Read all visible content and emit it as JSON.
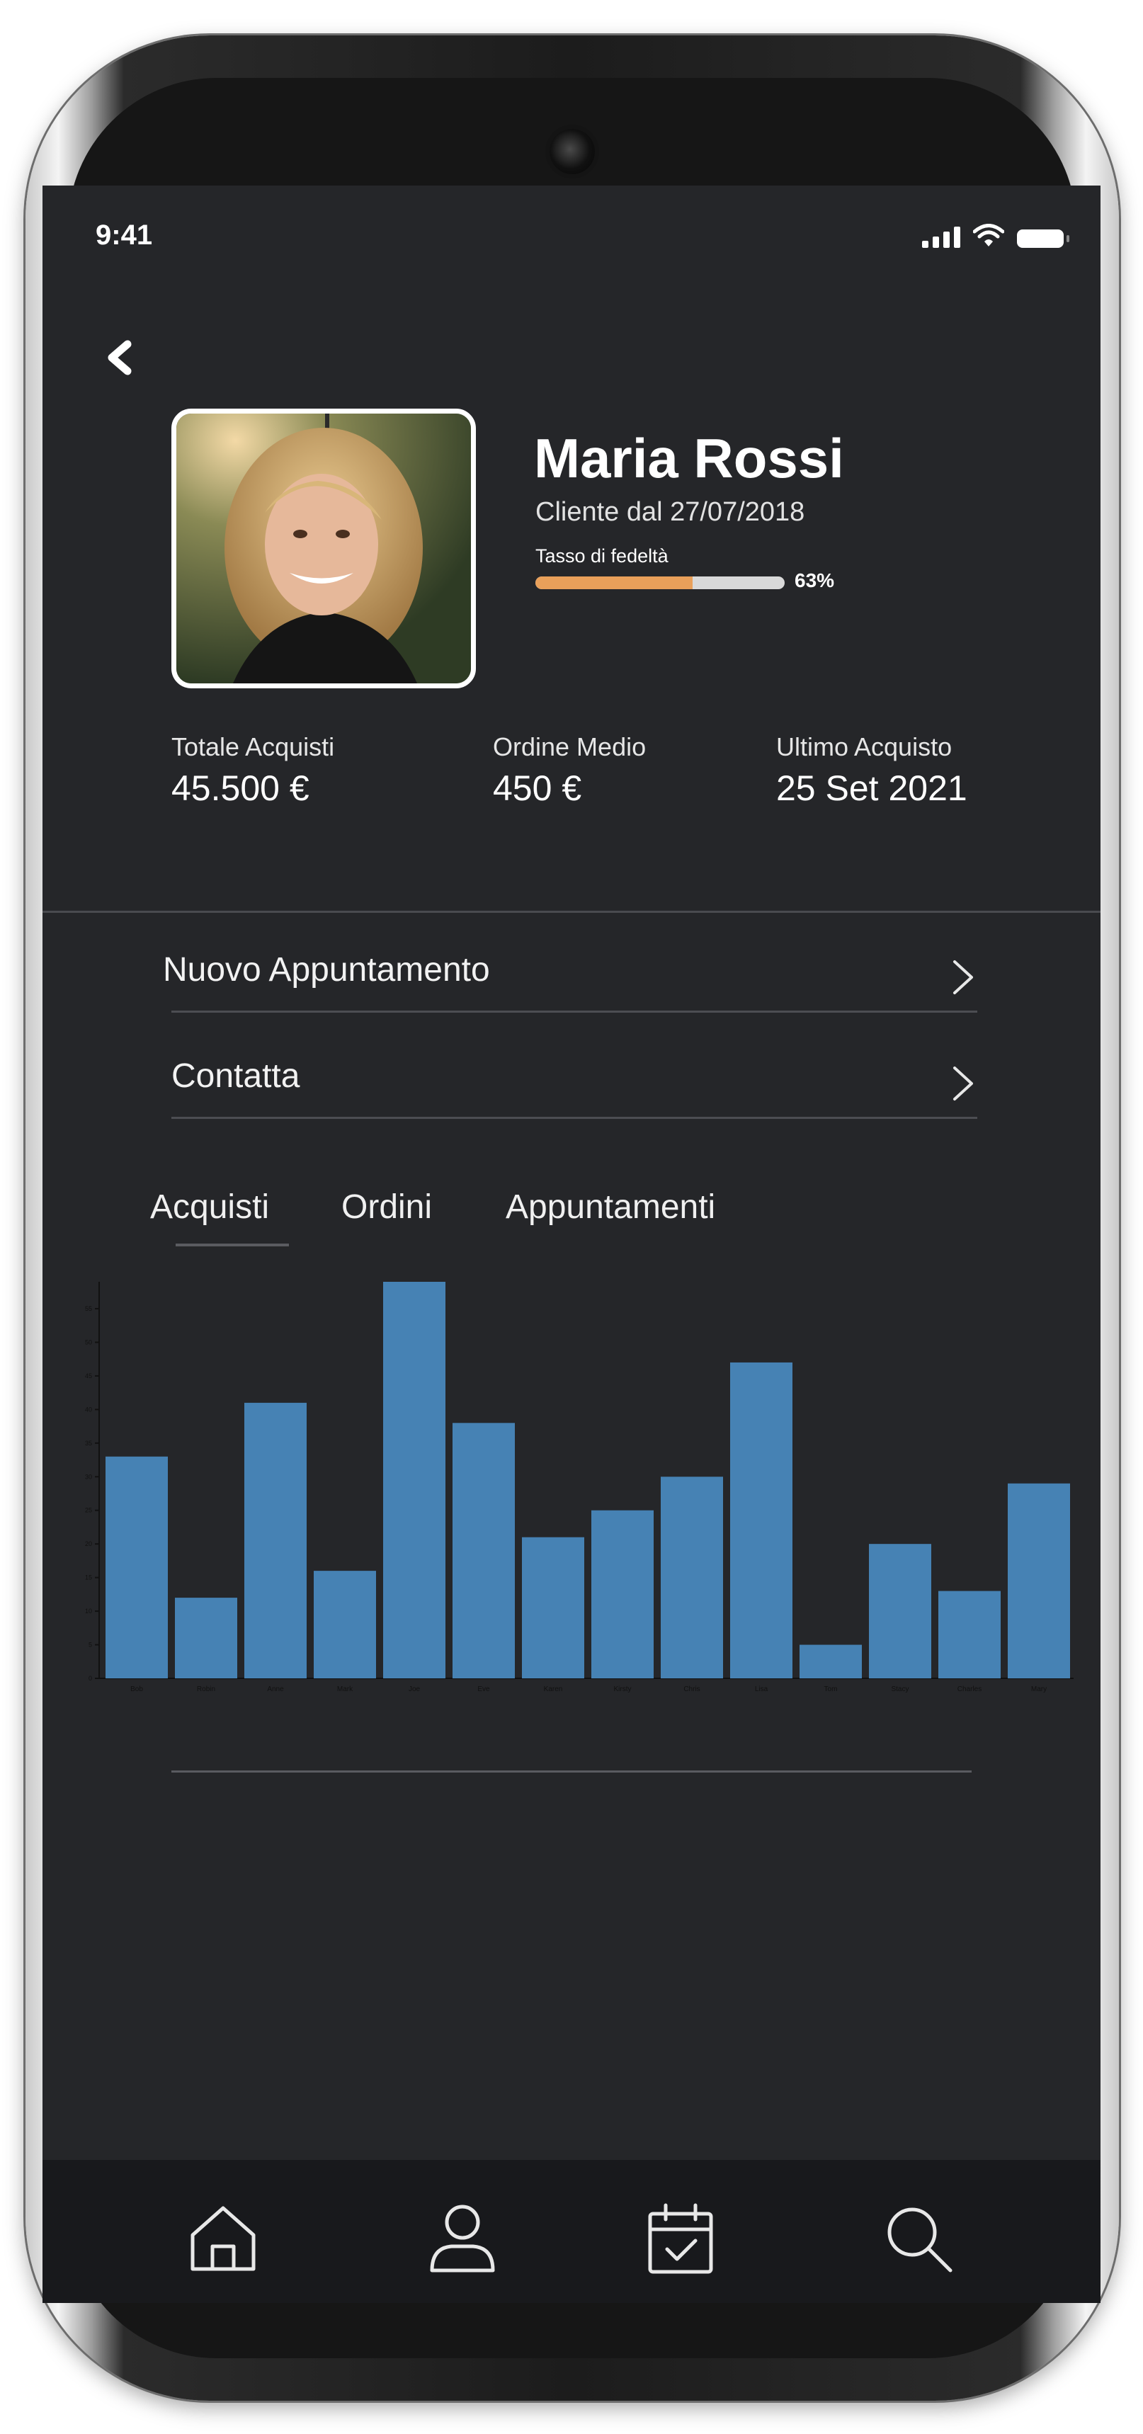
{
  "status": {
    "time": "9:41"
  },
  "profile": {
    "name": "Maria Rossi",
    "since": "Cliente dal 27/07/2018",
    "loyalty_label": "Tasso di fedeltà",
    "loyalty_percent_text": "63%",
    "loyalty_fraction": 0.63
  },
  "stats": [
    {
      "label": "Totale Acquisti",
      "value": "45.500 €"
    },
    {
      "label": "Ordine Medio",
      "value": "450 €"
    },
    {
      "label": "Ultimo Acquisto",
      "value": "25 Set 2021"
    }
  ],
  "menu": [
    {
      "label": "Nuovo Appuntamento"
    },
    {
      "label": "Contatta"
    }
  ],
  "tabs": [
    {
      "label": "Acquisti"
    },
    {
      "label": "Ordini"
    },
    {
      "label": "Appuntamenti"
    }
  ],
  "colors": {
    "background": "#252629",
    "bar": "#4682b4",
    "loyalty_fill": "#e9a05a",
    "loyalty_track": "#d9d9d9"
  },
  "icons": [
    "back-chevron-icon",
    "chevron-right-icon",
    "home-icon",
    "user-icon",
    "calendar-check-icon",
    "search-icon"
  ],
  "chart_data": {
    "type": "bar",
    "categories": [
      "Bob",
      "Robin",
      "Anne",
      "Mark",
      "Joe",
      "Eve",
      "Karen",
      "Kirsty",
      "Chris",
      "Lisa",
      "Tom",
      "Stacy",
      "Charles",
      "Mary"
    ],
    "values": [
      33,
      12,
      41,
      16,
      59,
      38,
      21,
      25,
      30,
      47,
      5,
      20,
      13,
      29
    ],
    "ylim": [
      0,
      59
    ],
    "yticks": [
      0,
      5,
      10,
      15,
      20,
      25,
      30,
      35,
      40,
      45,
      50,
      55
    ],
    "title": "",
    "xlabel": "",
    "ylabel": "",
    "grid": false,
    "legend": "none"
  }
}
